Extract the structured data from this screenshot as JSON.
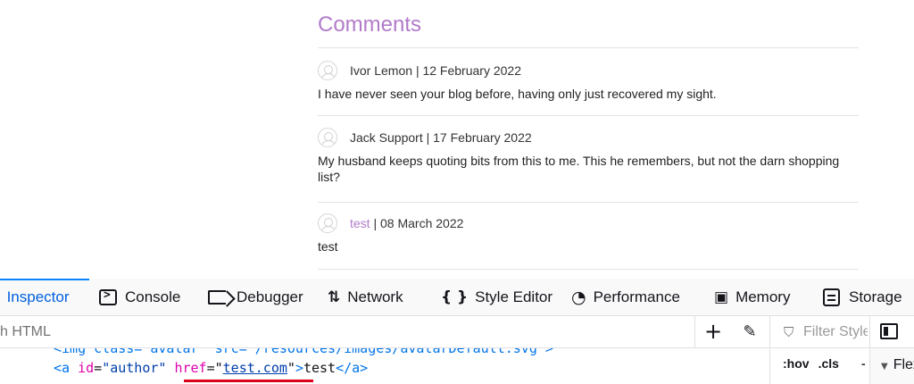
{
  "comments": {
    "title": "Comments",
    "items": [
      {
        "author": "Ivor Lemon",
        "date": "12 February 2022",
        "body": "I have never seen your blog before, having only just recovered my sight.",
        "author_is_link": false
      },
      {
        "author": "Jack Support",
        "date": "17 February 2022",
        "body": "My husband keeps quoting bits from this to me. This he remembers, but not the darn shopping list?",
        "author_is_link": false
      },
      {
        "author": "test",
        "date": "08 March 2022",
        "body": "test",
        "author_is_link": true
      }
    ],
    "separator": "|",
    "link_color": "#b27bc9"
  },
  "devtools": {
    "tabs": [
      {
        "label": "Inspector",
        "icon": "inspector-icon",
        "active": true
      },
      {
        "label": "Console",
        "icon": "console-icon"
      },
      {
        "label": "Debugger",
        "icon": "debugger-icon"
      },
      {
        "label": "Network",
        "icon": "network-icon"
      },
      {
        "label": "Style Editor",
        "icon": "style-editor-icon"
      },
      {
        "label": "Performance",
        "icon": "performance-icon"
      },
      {
        "label": "Memory",
        "icon": "memory-icon"
      },
      {
        "label": "Storage",
        "icon": "storage-icon"
      }
    ],
    "search_placeholder": "Search HTML",
    "search_visible": "h HTML",
    "filter_styles_placeholder": "Filter Styles",
    "pseudo_classes": [
      ":hov",
      ".cls"
    ],
    "layout_label": "Flex",
    "markup": {
      "ghost_line": "<img class=\"avatar\" src=\"/resources/images/avatarDefault.svg\">",
      "tag_open": "<a",
      "attr1_name": "id",
      "attr1_value": "\"author\"",
      "attr2_name": "href",
      "attr2_value": "test.com",
      "text": "test",
      "tag_close": "</a>"
    },
    "accent_color": "#0060df"
  }
}
